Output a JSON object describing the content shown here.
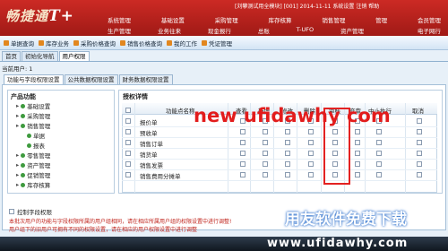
{
  "header": {
    "logo_text": "畅捷通",
    "logo_suffix": "T+",
    "user_info": "[刘攀测试用全模块] [001] 2014-11-11  系统设置  注销  帮助",
    "nav_top": [
      "系统管理",
      "基础设置",
      "采购管理",
      "库存核算",
      "销售管理",
      "管理",
      "会员管理"
    ],
    "nav_bottom": [
      "生产管理",
      "业务往来",
      "现金报行",
      "总账",
      "T-UFO",
      "资产管理",
      "",
      "电子网行"
    ]
  },
  "modules": [
    "单据查询",
    "库存业务",
    "采购价格查询",
    "销售价格查询",
    "我的工作",
    "凭证管理"
  ],
  "tabs": [
    "首页",
    "初始化导航",
    "用户权限"
  ],
  "current_user": "当前用户: 1",
  "sub_tabs": [
    "功能与字段权限设置",
    "公共数据权限设置",
    "财务数据权限设置"
  ],
  "left_panel": {
    "title": "产品功能",
    "tree": [
      {
        "label": "基础设置",
        "depth": 1
      },
      {
        "label": "采购管理",
        "depth": 1
      },
      {
        "label": "销售管理",
        "depth": 1
      },
      {
        "label": "单据",
        "depth": 2
      },
      {
        "label": "报表",
        "depth": 2
      },
      {
        "label": "零售管理",
        "depth": 1
      },
      {
        "label": "资产管理",
        "depth": 1
      },
      {
        "label": "促销管理",
        "depth": 1
      },
      {
        "label": "库存核算",
        "depth": 1
      }
    ]
  },
  "right_panel": {
    "title": "授权详情",
    "columns": [
      "功能点名称",
      "查看",
      "新增",
      "修改",
      "删除",
      "审核",
      "弃审",
      "中止执行",
      "取消"
    ],
    "rows": [
      "报价单",
      "预收单",
      "销售订单",
      "销货单",
      "销售发票",
      "销售费用分摊单"
    ],
    "checks": [
      [
        0,
        1,
        1,
        1,
        1,
        1,
        1,
        1,
        1
      ],
      [
        0,
        1,
        1,
        1,
        1,
        1,
        1,
        0,
        0
      ],
      [
        0,
        1,
        1,
        1,
        1,
        1,
        1,
        1,
        1
      ],
      [
        0,
        1,
        1,
        1,
        1,
        1,
        1,
        1,
        1
      ],
      [
        0,
        1,
        1,
        1,
        1,
        1,
        1,
        0,
        0
      ],
      [
        0,
        1,
        1,
        1,
        1,
        1,
        1,
        0,
        0
      ]
    ]
  },
  "field_control_label": "控制字段权限",
  "notes": [
    "本批次用户的功能与字段权限所属的用户组相同，请在相应所属用户组的权限设置中进行调整!",
    "用户组下的旧用户可拥有不同的权限设置，请在相应的用户权限设置中进行调整"
  ],
  "watermark": "new ufidawhy com",
  "promo": "用友软件免费下载",
  "site": "www.ufidawhy.com"
}
